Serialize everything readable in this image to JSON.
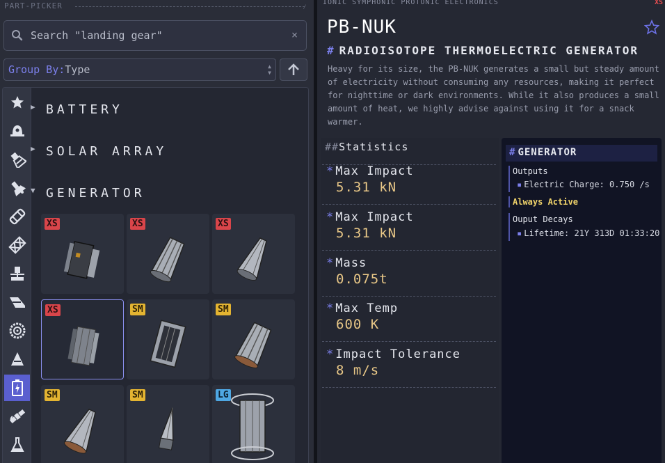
{
  "picker": {
    "title": "PART-PICKER",
    "search_placeholder": "Search \"landing gear\"",
    "clear_glyph": "×",
    "group_by_label": "Group By:",
    "group_by_value": "Type"
  },
  "rail_icons": [
    "star-icon",
    "command-pod-icon",
    "engine-icon",
    "rcs-thruster-icon",
    "fuel-tank-icon",
    "structural-icon",
    "docking-port-icon",
    "wing-icon",
    "wheel-icon",
    "nose-cone-icon",
    "battery-icon",
    "satellite-icon",
    "science-flask-icon"
  ],
  "groups": [
    {
      "label": "BATTERY",
      "expanded": false
    },
    {
      "label": "SOLAR ARRAY",
      "expanded": false
    },
    {
      "label": "GENERATOR",
      "expanded": true
    }
  ],
  "parts": [
    {
      "size": "XS",
      "art": "rtg-box"
    },
    {
      "size": "XS",
      "art": "rtg-cage"
    },
    {
      "size": "XS",
      "art": "rtg-cone"
    },
    {
      "size": "XS",
      "art": "rtg-fins",
      "selected": true
    },
    {
      "size": "SM",
      "art": "rtg-panel"
    },
    {
      "size": "SM",
      "art": "rtg-cage"
    },
    {
      "size": "SM",
      "art": "rtg-cone"
    },
    {
      "size": "SM",
      "art": "rtg-needle"
    },
    {
      "size": "LG",
      "art": "rtg-cylinder"
    }
  ],
  "detail": {
    "manufacturer": "IONIC SYMPHONIC PROTONIC ELECTRONICS",
    "size": "XS",
    "name": "PB-NUK",
    "type": "RADIOISOTOPE THERMOELECTRIC GENERATOR",
    "description": "Heavy for its size, the PB-NUK generates a small but steady amount of electricity without consuming any resources, making it perfect for nighttime or dark environments. While it also produces a small amount of heat, we highly advise against using it for a snack warmer.",
    "statistics_title": "Statistics",
    "stats": [
      {
        "label": "Max Impact",
        "value": "5.31 kN"
      },
      {
        "label": "Max Impact",
        "value": "5.31 kN"
      },
      {
        "label": "Mass",
        "value": "0.075t"
      },
      {
        "label": "Max Temp",
        "value": "600 K"
      },
      {
        "label": "Impact Tolerance",
        "value": "8 m/s"
      }
    ],
    "generator": {
      "title": "GENERATOR",
      "outputs_label": "Outputs",
      "output_item": "Electric Charge: 0.750 /s",
      "status": "Always Active",
      "decay_label": "Ouput Decays",
      "decay_item": "Lifetime: 21Y 313D 01:33:20"
    }
  },
  "colors": {
    "accent": "#7c80ec",
    "xs": "#d9454a",
    "sm": "#e4b431",
    "lg": "#4ea7e3",
    "value": "#e8c787"
  }
}
